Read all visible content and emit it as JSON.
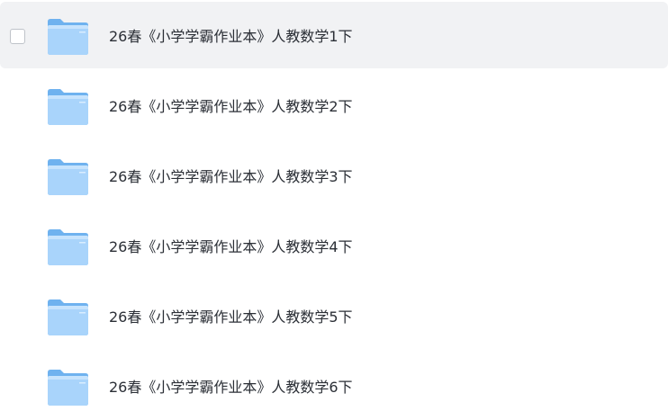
{
  "file_list": {
    "items": [
      {
        "name": "26春《小学学霸作业本》人教数学1下",
        "type": "folder",
        "hovered": true
      },
      {
        "name": "26春《小学学霸作业本》人教数学2下",
        "type": "folder"
      },
      {
        "name": "26春《小学学霸作业本》人教数学3下",
        "type": "folder"
      },
      {
        "name": "26春《小学学霸作业本》人教数学4下",
        "type": "folder"
      },
      {
        "name": "26春《小学学霸作业本》人教数学5下",
        "type": "folder"
      },
      {
        "name": "26春《小学学霸作业本》人教数学6下",
        "type": "folder"
      }
    ]
  },
  "icons": {
    "folder": "folder-icon",
    "checkbox": "checkbox-icon"
  },
  "colors": {
    "hover_background": "#f1f2f4",
    "folder_front": "#a9d4fb",
    "folder_back": "#6fb2ef",
    "text": "#2b2f36"
  }
}
